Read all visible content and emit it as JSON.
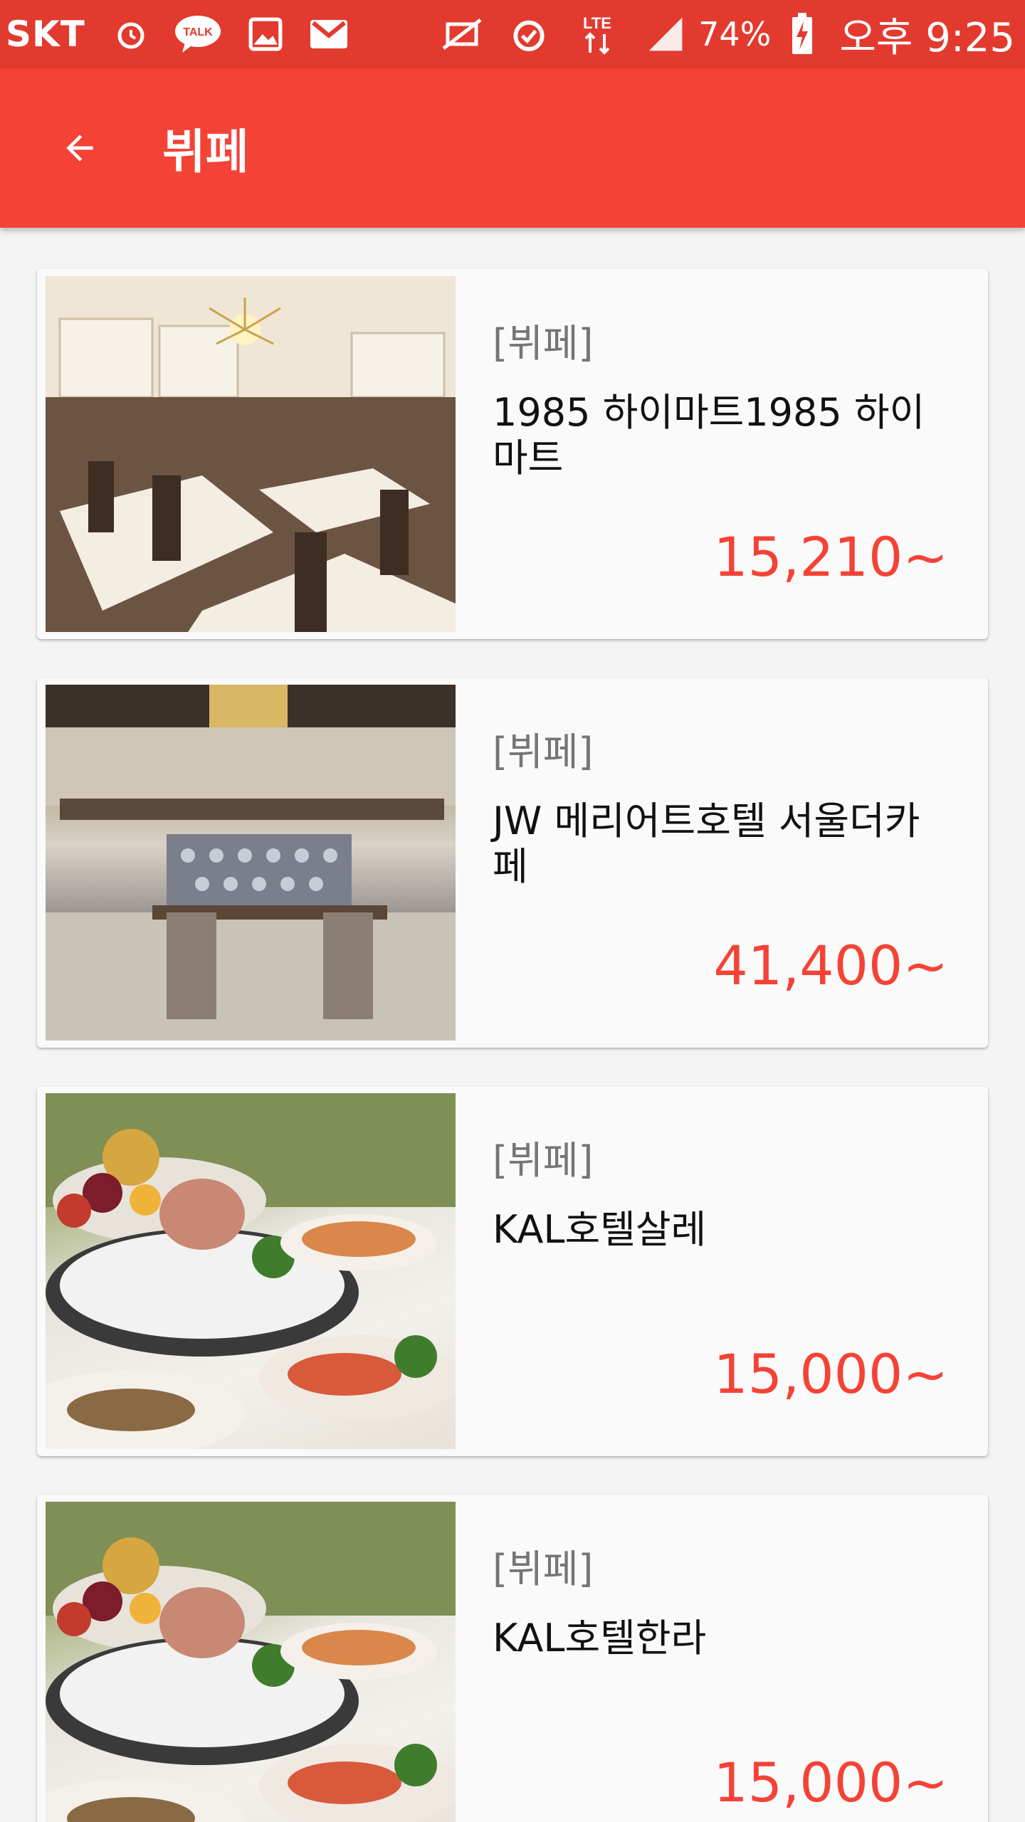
{
  "status_bar": {
    "carrier": "SKT",
    "network": "LTE",
    "battery": "74%",
    "time": "오후 9:25",
    "icons": [
      "alarm-icon",
      "kakaotalk-icon",
      "gallery-icon",
      "gmail-icon",
      "mute-icon",
      "alarm-icon",
      "lte-icon",
      "signal-icon",
      "battery-charging-icon"
    ]
  },
  "app_bar": {
    "title": "뷔페",
    "back_icon": "arrow-back-icon"
  },
  "items": [
    {
      "category": "[뷔페]",
      "name": "1985 하이마트1985 하이마트",
      "price": "15,210~",
      "image": "restaurant-interior"
    },
    {
      "category": "[뷔페]",
      "name": "JW 메리어트호텔 서울더카페",
      "price": "41,400~",
      "image": "hotel-restaurant-interior"
    },
    {
      "category": "[뷔페]",
      "name": "KAL호텔살레",
      "price": "15,000~",
      "image": "buffet-food-platter"
    },
    {
      "category": "[뷔페]",
      "name": "KAL호텔한라",
      "price": "15,000~",
      "image": "buffet-food-platter"
    }
  ],
  "colors": {
    "primary": "#f44336",
    "status_bar": "#e23a2f",
    "price": "#f44336",
    "category": "#757575"
  }
}
